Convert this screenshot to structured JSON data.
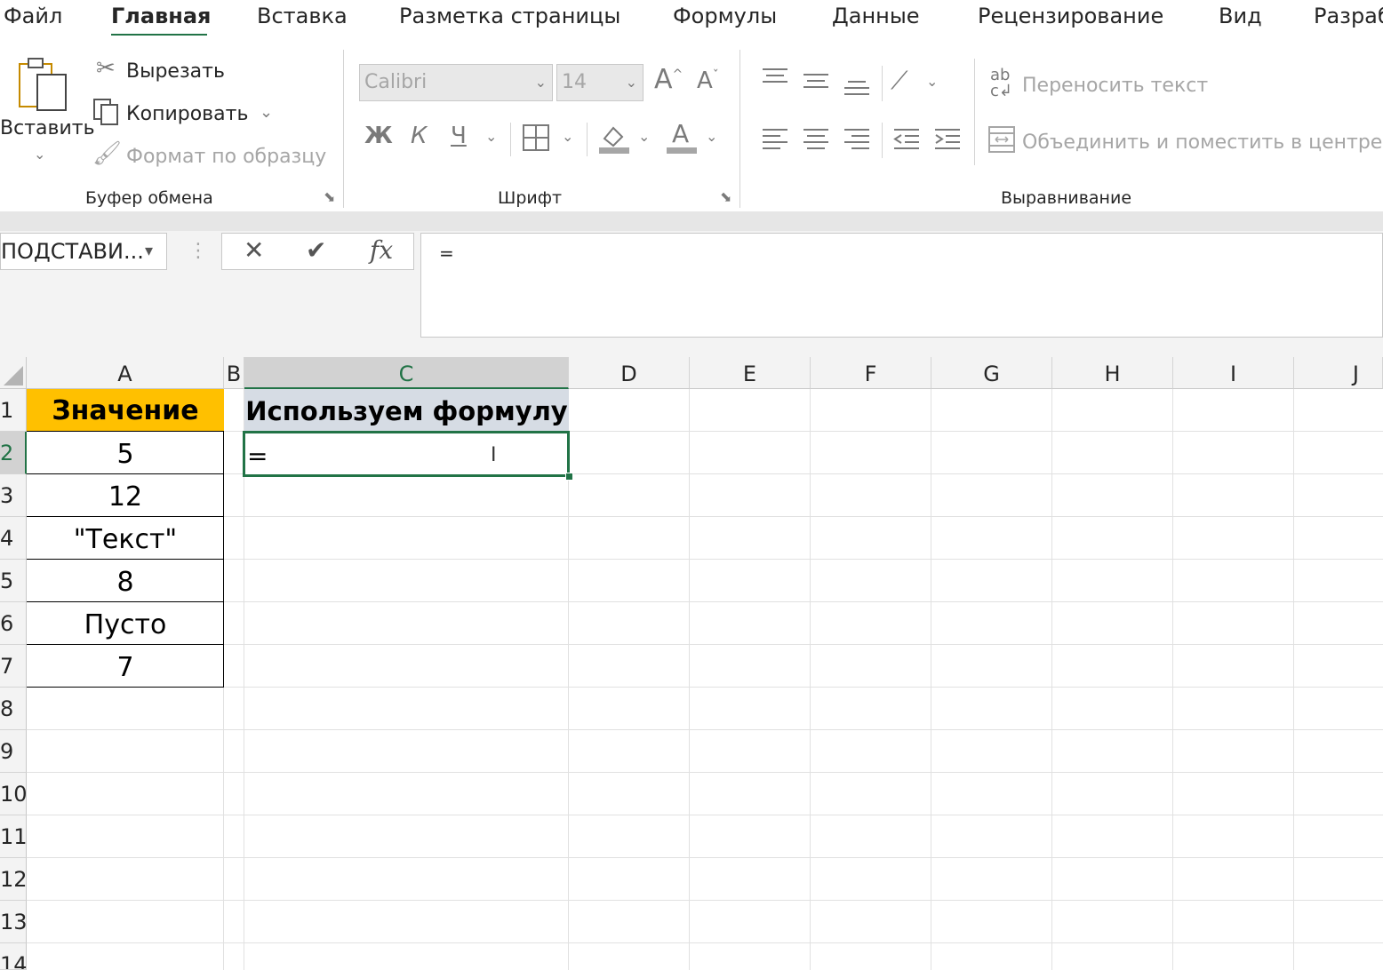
{
  "tabs": [
    "Файл",
    "Главная",
    "Вставка",
    "Разметка страницы",
    "Формулы",
    "Данные",
    "Рецензирование",
    "Вид",
    "Разраб"
  ],
  "clipboard": {
    "paste_label": "Вставить",
    "cut_label": "Вырезать",
    "copy_label": "Копировать",
    "format_painter_label": "Формат по образцу",
    "group_label": "Буфер обмена"
  },
  "font": {
    "font_name": "Calibri",
    "font_size": "14",
    "grow_label": "A",
    "shrink_label": "A",
    "bold_label": "Ж",
    "italic_label": "К",
    "underline_label": "Ч",
    "font_color_label": "A",
    "group_label": "Шрифт"
  },
  "alignment": {
    "wrap_text_label": "Переносить текст",
    "merge_center_label": "Объединить и поместить в центре",
    "group_label": "Выравнивание"
  },
  "formula_bar": {
    "name_box": "ПОДСТАВИ...",
    "fx_label": "fx",
    "formula": "="
  },
  "columns": [
    "A",
    "B",
    "C",
    "D",
    "E",
    "F",
    "G",
    "H",
    "I",
    "J"
  ],
  "rows": [
    "1",
    "2",
    "3",
    "4",
    "5",
    "6",
    "7",
    "8",
    "9",
    "10",
    "11",
    "12",
    "13",
    "14"
  ],
  "cells": {
    "A1": "Значение",
    "C1": "Используем формулу",
    "A2": "5",
    "A3": "12",
    "A4": "\"Текст\"",
    "A5": "8",
    "A6": "Пусто",
    "A7": "7",
    "C2": "="
  },
  "colors": {
    "accent": "#217346",
    "header_a1": "#FFC000",
    "header_c1": "#D6DCE4"
  }
}
